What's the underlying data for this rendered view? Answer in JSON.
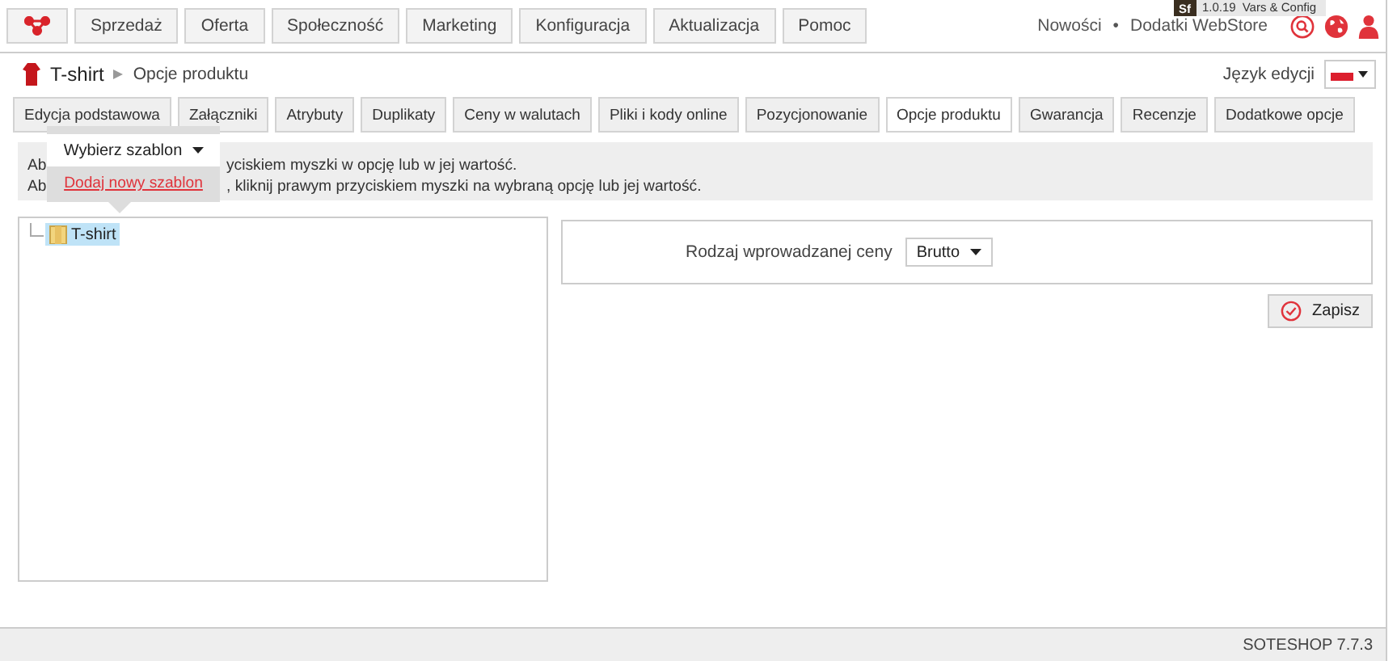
{
  "debug_toolbar": {
    "logo": "Sf",
    "version": "1.0.19",
    "config": "Vars & Config"
  },
  "top_menu": [
    {
      "label": "Sprzedaż"
    },
    {
      "label": "Oferta"
    },
    {
      "label": "Społeczność"
    },
    {
      "label": "Marketing"
    },
    {
      "label": "Konfiguracja"
    },
    {
      "label": "Aktualizacja"
    },
    {
      "label": "Pomoc"
    }
  ],
  "top_links": {
    "news": "Nowości",
    "separator": "•",
    "webstore": "Dodatki WebStore"
  },
  "breadcrumb": {
    "product": "T-shirt",
    "page": "Opcje produktu"
  },
  "edit_language": {
    "label": "Język edycji"
  },
  "tabs": [
    {
      "label": "Edycja podstawowa",
      "selected": false
    },
    {
      "label": "Załączniki",
      "selected": false
    },
    {
      "label": "Atrybuty",
      "selected": false
    },
    {
      "label": "Duplikaty",
      "selected": false
    },
    {
      "label": "Ceny w walutach",
      "selected": false
    },
    {
      "label": "Pliki i kody online",
      "selected": false
    },
    {
      "label": "Pozycjonowanie",
      "selected": false
    },
    {
      "label": "Opcje produktu",
      "selected": true
    },
    {
      "label": "Gwarancja",
      "selected": false
    },
    {
      "label": "Recenzje",
      "selected": false
    },
    {
      "label": "Dodatkowe opcje",
      "selected": false
    }
  ],
  "info_lines": [
    {
      "start": "Ab",
      "rest": "yciskiem myszki w opcję lub w jej wartość."
    },
    {
      "start": "Ab",
      "rest": ", kliknij prawym przyciskiem myszki na wybraną opcję lub jej wartość."
    }
  ],
  "template_popup": {
    "select": "Wybierz szablon",
    "link": "Dodaj nowy szablon"
  },
  "tree": [
    {
      "label": "T-shirt",
      "selected": true
    }
  ],
  "price_field": {
    "label": "Rodzaj wprowadzanej ceny",
    "value": "Brutto"
  },
  "save_button": "Zapisz",
  "footer": "SOTESHOP 7.7.3"
}
